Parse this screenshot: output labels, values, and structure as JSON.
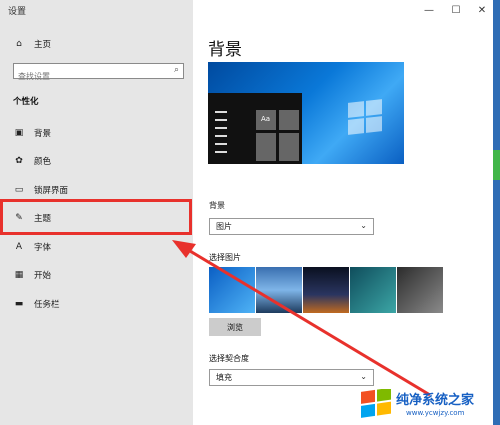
{
  "window": {
    "title": "设置",
    "minimize": "—",
    "maximize": "☐",
    "close": "✕"
  },
  "sidebar": {
    "home": "主页",
    "search_placeholder": "查找设置",
    "section": "个性化",
    "items": [
      {
        "label": "背景",
        "icon": "image-icon"
      },
      {
        "label": "颜色",
        "icon": "palette-icon"
      },
      {
        "label": "锁屏界面",
        "icon": "lock-screen-icon"
      },
      {
        "label": "主题",
        "icon": "theme-icon"
      },
      {
        "label": "字体",
        "icon": "font-icon"
      },
      {
        "label": "开始",
        "icon": "start-icon"
      },
      {
        "label": "任务栏",
        "icon": "taskbar-icon"
      }
    ]
  },
  "main": {
    "title": "背景",
    "preview_sample": "Aa",
    "background_label": "背景",
    "background_value": "图片",
    "choose_picture_label": "选择图片",
    "browse_label": "浏览",
    "fit_label": "选择契合度",
    "fit_value": "填充"
  },
  "watermark": {
    "name": "纯净系统之家",
    "url": "www.ycwjzy.com"
  },
  "colors": {
    "accent_highlight": "#e8312c",
    "sidebar_bg": "#e6e6e6"
  }
}
